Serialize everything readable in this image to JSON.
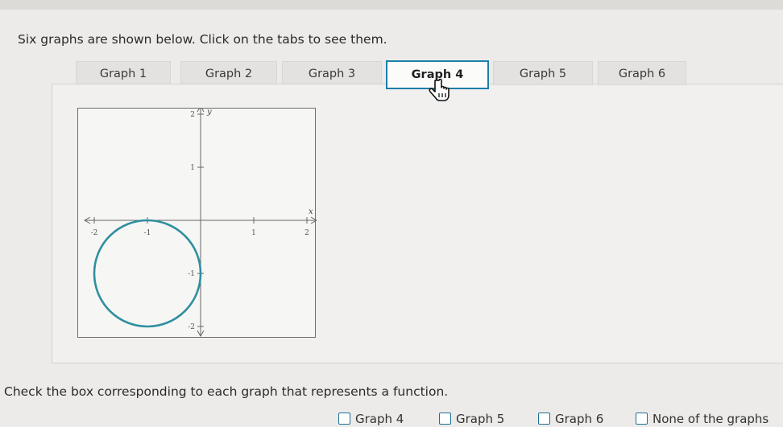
{
  "instruction": "Six graphs are shown below. Click on the tabs to see them.",
  "tabs": [
    {
      "label": "Graph 1",
      "active": false
    },
    {
      "label": "Graph 2",
      "active": false
    },
    {
      "label": "Graph 3",
      "active": false
    },
    {
      "label": "Graph 4",
      "active": true
    },
    {
      "label": "Graph 5",
      "active": false
    },
    {
      "label": "Graph 6",
      "active": false
    }
  ],
  "graph": {
    "x_axis_label": "x",
    "y_axis_label": "y",
    "x_ticks": [
      "-2",
      "-1",
      "1",
      "2"
    ],
    "y_ticks": [
      "2",
      "1",
      "-1",
      "-2"
    ],
    "circle": {
      "center_x": -1,
      "center_y": -1,
      "radius": 1
    },
    "xlim": [
      -2,
      2
    ],
    "ylim": [
      -2,
      2
    ],
    "curve_color": "#2f8fa0"
  },
  "question": "Check the box corresponding to each graph that represents a function.",
  "checkboxes": [
    {
      "label": "Graph 4"
    },
    {
      "label": "Graph 5"
    },
    {
      "label": "Graph 6"
    },
    {
      "label": "None of the graphs"
    }
  ],
  "colors": {
    "accent": "#1d7fa8",
    "checkbox_border": "#1d6f94"
  },
  "cursor_icon": "hand-pointer-icon"
}
